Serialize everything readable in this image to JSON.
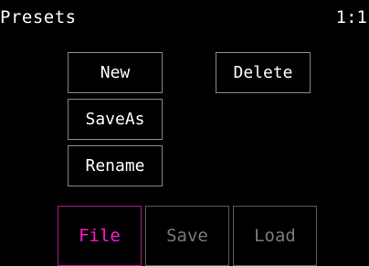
{
  "header": {
    "title": "Presets",
    "page_indicator": "1:1"
  },
  "actions": {
    "new_label": "New",
    "delete_label": "Delete",
    "saveas_label": "SaveAs",
    "rename_label": "Rename"
  },
  "tabs": [
    {
      "label": "File",
      "active": true
    },
    {
      "label": "Save",
      "active": false
    },
    {
      "label": "Load",
      "active": false
    }
  ],
  "colors": {
    "background": "#000000",
    "text": "#ffffff",
    "button_border": "#8a8a8a",
    "active_tab_text": "#ff1ad0",
    "active_tab_border": "#ad1e8c",
    "inactive_tab_text": "#7a7a7a"
  }
}
